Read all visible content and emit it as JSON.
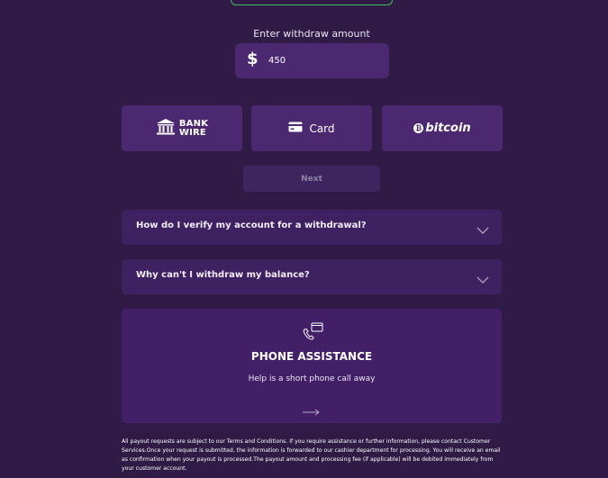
{
  "withdraw": {
    "label": "Enter withdraw amount",
    "currency_symbol": "$",
    "amount_value": "450"
  },
  "methods": [
    {
      "id": "bank-wire",
      "label_line1": "BANK",
      "label_line2": "WIRE",
      "icon": "bank-icon"
    },
    {
      "id": "card",
      "label": "Card",
      "icon": "credit-card-icon"
    },
    {
      "id": "bitcoin",
      "label": "bitcoin",
      "icon": "bitcoin-icon"
    }
  ],
  "next_label": "Next",
  "faq": [
    {
      "question": "How do I verify my account for a withdrawal?",
      "icon": "chevron-down-icon"
    },
    {
      "question": "Why can't I withdraw my balance?",
      "icon": "chevron-down-icon"
    }
  ],
  "phone_assistance": {
    "title": "PHONE ASSISTANCE",
    "subtitle": "Help is a short phone call away",
    "icon": "phone-card-icon",
    "arrow_icon": "arrow-right-icon"
  },
  "disclaimer": "All payout requests are subject to our Terms and Conditions. If you require assistance or further information, please contact Customer Services.Once your request is submitted, the information is forwarded to our cashier department for processing. You will receive an email as confirmation when your payout is processed.The payout amount and processing fee (if applicable) will be debited immediately from your customer account.",
  "colors": {
    "background": "#2f1b45",
    "panel": "#4b2870",
    "faq_panel": "#3e2160",
    "next_disabled": "#3e2560"
  }
}
